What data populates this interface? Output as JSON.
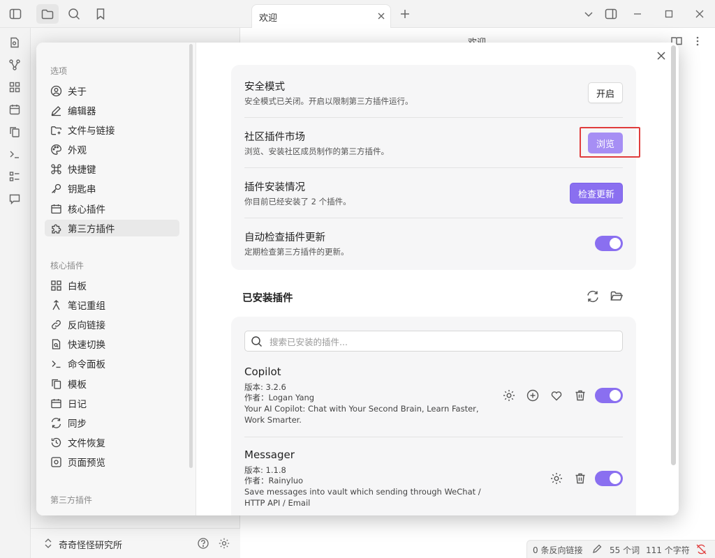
{
  "app": {
    "tab_title": "欢迎",
    "note_title": "欢迎",
    "vault_name": "奇奇怪怪研究所",
    "status": {
      "backlinks": "0 条反向链接",
      "words": "55 个词",
      "chars": "111 个字符"
    }
  },
  "modal": {
    "nav": {
      "groups": [
        {
          "title": "选项",
          "items": [
            "关于",
            "编辑器",
            "文件与链接",
            "外观",
            "快捷键",
            "钥匙串",
            "核心插件",
            "第三方插件"
          ]
        },
        {
          "title": "核心插件",
          "items": [
            "白板",
            "笔记重组",
            "反向链接",
            "快速切换",
            "命令面板",
            "模板",
            "日记",
            "同步",
            "文件恢复",
            "页面预览"
          ]
        },
        {
          "title": "第三方插件",
          "items": []
        }
      ],
      "active_item": "第三方插件"
    },
    "settings": {
      "safe_mode": {
        "title": "安全模式",
        "desc": "安全模式已关闭。开启以限制第三方插件运行。",
        "button": "开启"
      },
      "community": {
        "title": "社区插件市场",
        "desc": "浏览、安装社区成员制作的第三方插件。",
        "button": "浏览"
      },
      "install_status": {
        "title": "插件安装情况",
        "desc": "你目前已经安装了 2 个插件。",
        "button": "检查更新"
      },
      "auto_update": {
        "title": "自动检查插件更新",
        "desc": "定期检查第三方插件的更新。",
        "enabled": true
      }
    },
    "installed": {
      "title": "已安装插件",
      "search_placeholder": "搜索已安装的插件...",
      "plugins": [
        {
          "name": "Copilot",
          "version": "版本: 3.2.6",
          "author": "作者：Logan Yang",
          "desc": "Your AI Copilot: Chat with Your Second Brain, Learn Faster, Work Smarter.",
          "enabled": true
        },
        {
          "name": "Messager",
          "version": "版本: 1.1.8",
          "author": "作者：Rainyluo",
          "desc": "Save messages into vault which sending through WeChat / HTTP API / Email",
          "enabled": true
        }
      ]
    }
  },
  "colors": {
    "accent": "#8a6ff0",
    "highlight": "#e03c3c"
  },
  "icons": [
    "sidebar-toggle-icon",
    "folder-icon",
    "search-icon",
    "bookmark-icon",
    "close-icon",
    "plus-icon",
    "chevron-down-icon",
    "layout-icon",
    "minimize-icon",
    "maximize-icon",
    "gear-icon",
    "help-icon",
    "refresh-icon",
    "folder-open-icon",
    "plus-circle-icon",
    "heart-icon",
    "trash-icon",
    "book-icon",
    "more-icon"
  ]
}
